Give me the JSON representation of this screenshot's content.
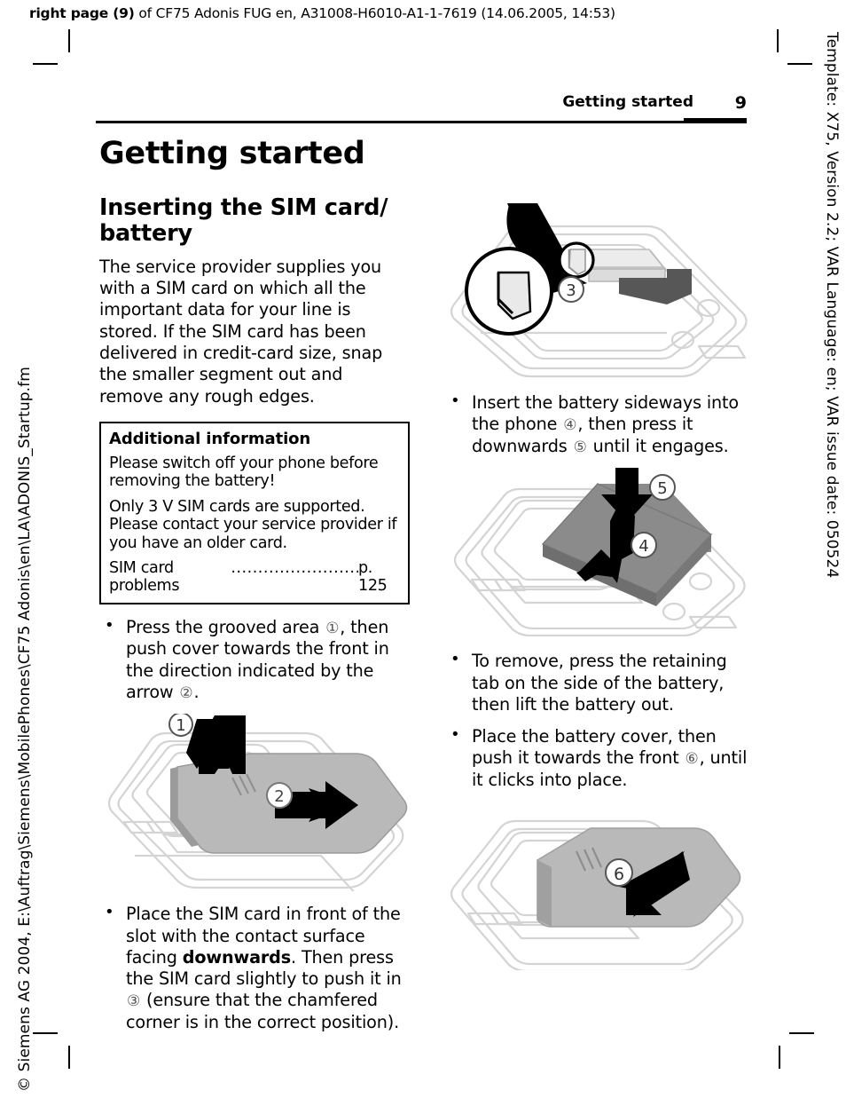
{
  "printer_slug": {
    "prefix": "right page (9)",
    "rest": " of CF75 Adonis FUG en, A31008-H6010-A1-1-7619 (14.06.2005, 14:53)"
  },
  "side_slugs": {
    "right": "Template: X75, Version 2.2; VAR Language: en; VAR issue date: 050524",
    "left": "© Siemens AG 2004, E:\\Auftrag\\Siemens\\MobilePhones\\CF75 Adonis\\en\\LA\\ADONIS_Startup.fm"
  },
  "header": {
    "chapter": "Getting started",
    "page_number": "9"
  },
  "main": {
    "chapter_title": "Getting started",
    "section_title": "Inserting the SIM card/ battery",
    "intro_paragraph": "The service provider supplies you with a SIM card on which all the important data for your line is stored. If the SIM card has been delivered in credit-card size, snap the smaller segment out and remove any rough edges."
  },
  "infobox": {
    "title": "Additional information",
    "paragraph_1": "Please switch off your phone before removing the battery!",
    "paragraph_2": "Only 3 V SIM cards are supported. Please contact your service provider if you have an older card.",
    "xref_label": "SIM card problems",
    "xref_dots": "...........................",
    "xref_page": "p. 125"
  },
  "bullets_left": [
    {
      "id": "press-grooved-area",
      "parts": [
        {
          "t": "text",
          "v": "Press the grooved area "
        },
        {
          "t": "callout",
          "v": "①"
        },
        {
          "t": "text",
          "v": ", then push cover towards the front in the direction indicated by the arrow "
        },
        {
          "t": "callout",
          "v": "②"
        },
        {
          "t": "text",
          "v": "."
        }
      ]
    },
    {
      "id": "place-sim-card",
      "parts": [
        {
          "t": "text",
          "v": "Place the SIM card in front of the slot with the contact surface facing "
        },
        {
          "t": "bold",
          "v": "downwards"
        },
        {
          "t": "text",
          "v": ". Then press the SIM card slightly to push it in "
        },
        {
          "t": "callout",
          "v": "③"
        },
        {
          "t": "text",
          "v": " (ensure that the chamfered corner is in the correct position)."
        }
      ]
    }
  ],
  "bullets_right": [
    {
      "id": "insert-battery",
      "parts": [
        {
          "t": "text",
          "v": "Insert the battery sideways into the phone "
        },
        {
          "t": "callout",
          "v": "④"
        },
        {
          "t": "text",
          "v": ", then press it downwards "
        },
        {
          "t": "callout",
          "v": "⑤"
        },
        {
          "t": "text",
          "v": " until it engages."
        }
      ]
    },
    {
      "id": "remove-battery",
      "parts": [
        {
          "t": "text",
          "v": "To remove, press the retaining tab on the side of the battery, then lift the battery out."
        }
      ]
    },
    {
      "id": "place-battery-cover",
      "parts": [
        {
          "t": "text",
          "v": "Place the battery cover, then push it towards the front "
        },
        {
          "t": "callout",
          "v": "⑥"
        },
        {
          "t": "text",
          "v": ", until it clicks into place."
        }
      ]
    }
  ],
  "figures": {
    "sim_insert": {
      "name": "phone-sim-card-insertion-diagram",
      "callouts": [
        "③"
      ]
    },
    "cover_remove": {
      "name": "phone-battery-cover-removal-diagram",
      "callouts": [
        "①",
        "②"
      ]
    },
    "battery_insert": {
      "name": "phone-battery-insertion-diagram",
      "callouts": [
        "④",
        "⑤"
      ]
    },
    "cover_replace": {
      "name": "phone-battery-cover-replace-diagram",
      "callouts": [
        "⑥"
      ]
    }
  },
  "colors": {
    "ink": "#000000",
    "page": "#ffffff",
    "outline": "#d8d8d8",
    "battery_grey": "#8c8c8c",
    "cover_grey": "#b0b0b0",
    "callout_grey": "#555555"
  }
}
